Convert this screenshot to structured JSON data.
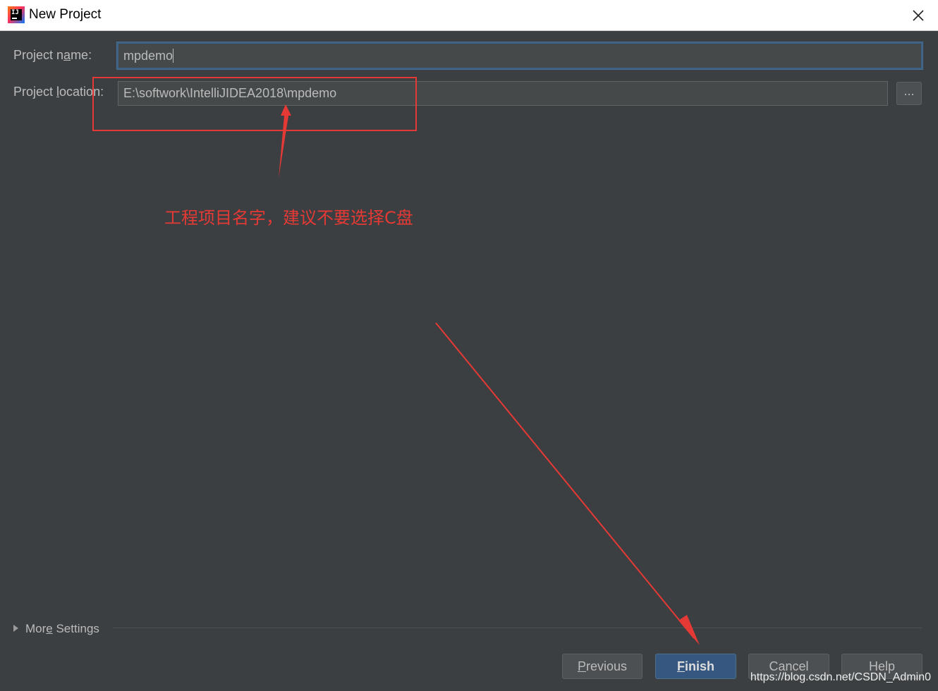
{
  "window": {
    "title": "New Project",
    "app_icon": "intellij-idea-icon",
    "close_icon": "close-icon"
  },
  "form": {
    "name_label_pre": "Project n",
    "name_label_mn": "a",
    "name_label_post": "me:",
    "name_value": "mpdemo",
    "location_label_pre": "Project ",
    "location_label_mn": "l",
    "location_label_post": "ocation:",
    "location_value": "E:\\softwork\\IntelliJIDEA2018\\mpdemo",
    "browse_label": "..."
  },
  "more_settings": {
    "pre": "Mor",
    "mn": "e",
    "post": " Settings"
  },
  "buttons": {
    "previous_mn": "P",
    "previous_rest": "revious",
    "finish_mn": "F",
    "finish_rest": "inish",
    "cancel": "Cancel",
    "help": "Help"
  },
  "annotation": {
    "text": "工程项目名字，建议不要选择C盘",
    "color": "#e53935"
  },
  "watermark": "https://blog.csdn.net/CSDN_Admin0",
  "colors": {
    "dialog_bg": "#3c3f41",
    "field_bg": "#45494a",
    "primary_button": "#365880",
    "focus_border": "#3d6185"
  }
}
